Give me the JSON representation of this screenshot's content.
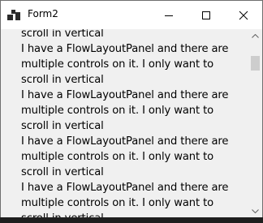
{
  "window": {
    "title": "Form2"
  },
  "controls": {
    "minimize": "minimize",
    "maximize": "maximize",
    "close": "close"
  },
  "content": {
    "lines": [
      "scroll in vertical",
      "I have a FlowLayoutPanel and there are",
      "multiple controls on it. I only want to",
      "scroll in vertical",
      "I have a FlowLayoutPanel and there are",
      "multiple controls on it. I only want to",
      "scroll in vertical",
      "I have a FlowLayoutPanel and there are",
      "multiple controls on it. I only want to",
      "scroll in vertical",
      "I have a FlowLayoutPanel and there are",
      "multiple controls on it. I only want to",
      "scroll in vertical"
    ]
  },
  "colors": {
    "titlebar": "#ffffff",
    "client": "#f0f0f0",
    "scroll_thumb": "#cdcdcd",
    "text": "#000000"
  }
}
